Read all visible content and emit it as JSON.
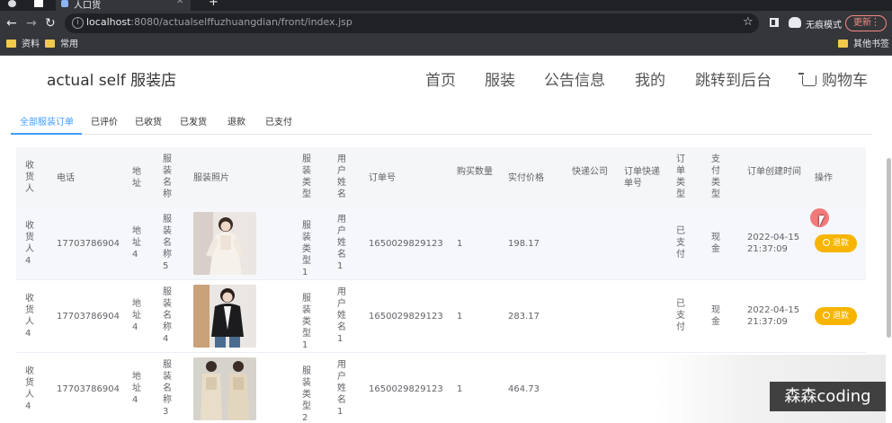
{
  "browser": {
    "tab_title": "人口货",
    "url_host": "localhost",
    "url_rest": ":8080/actualselffuzhuangdian/front/index.jsp",
    "incognito_label": "无痕模式",
    "update_label": "更新",
    "bookmarks": [
      "资料",
      "常用"
    ],
    "other_bookmarks": "其他书签"
  },
  "site": {
    "logo": "actual self 服装店",
    "nav": [
      "首页",
      "服装",
      "公告信息",
      "我的",
      "跳转到后台",
      "购物车"
    ]
  },
  "order_tabs": [
    "全部服装订单",
    "已评价",
    "已收货",
    "已发货",
    "退款",
    "已支付"
  ],
  "table": {
    "headers": [
      "收货人",
      "电话",
      "地址",
      "服装名称",
      "服装照片",
      "服装类型",
      "用户姓名",
      "订单号",
      "购买数量",
      "实付价格",
      "快递公司",
      "订单快递单号",
      "订单类型",
      "支付类型",
      "订单创建时间",
      "操作"
    ],
    "rows": [
      {
        "receiver": "收货人4",
        "phone": "17703786904",
        "address": "地址4",
        "name": "服装名称5",
        "type": "服装类型1",
        "user": "用户姓名1",
        "order_no": "1650029829123",
        "qty": "1",
        "price": "198.17",
        "courier": "",
        "tracking": "",
        "order_type": "已支付",
        "pay_type": "现金",
        "date": "2022-04-15",
        "time": "21:37:09",
        "action": "退款"
      },
      {
        "receiver": "收货人4",
        "phone": "17703786904",
        "address": "地址4",
        "name": "服装名称4",
        "type": "服装类型1",
        "user": "用户姓名1",
        "order_no": "1650029829123",
        "qty": "1",
        "price": "283.17",
        "courier": "",
        "tracking": "",
        "order_type": "已支付",
        "pay_type": "现金",
        "date": "2022-04-15",
        "time": "21:37:09",
        "action": "退款"
      },
      {
        "receiver": "收货人4",
        "phone": "17703786904",
        "address": "地址4",
        "name": "服装名称3",
        "type": "服装类型2",
        "user": "用户姓名1",
        "order_no": "1650029829123",
        "qty": "1",
        "price": "464.73",
        "courier": "",
        "tracking": "",
        "order_type": "",
        "pay_type": "",
        "date": "",
        "time": "",
        "action": ""
      }
    ]
  },
  "watermark": "森森coding",
  "colors": {
    "accent": "#409eff",
    "refund_button": "#f7b500",
    "header_bg": "#f5f6f8"
  }
}
